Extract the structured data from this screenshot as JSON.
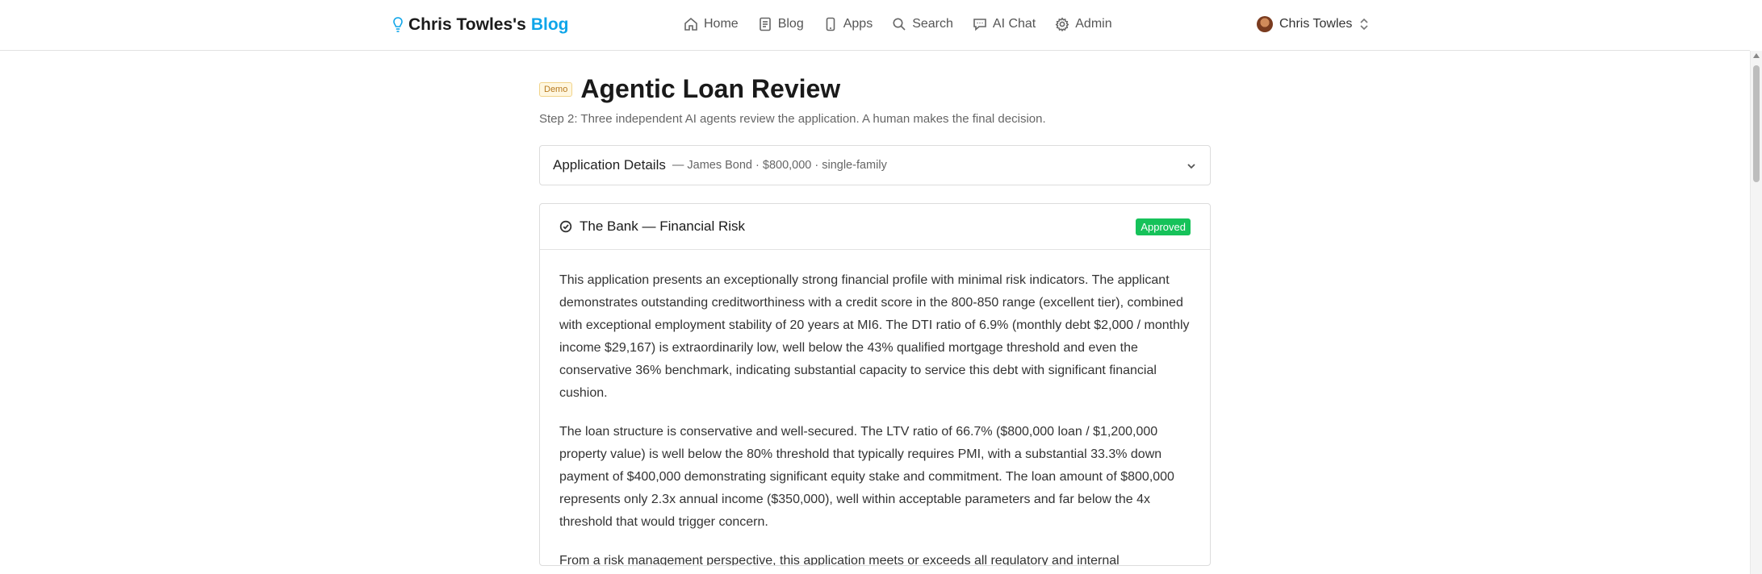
{
  "header": {
    "brand_name": "Chris Towles's",
    "brand_accent": "Blog",
    "nav": [
      {
        "label": "Home",
        "icon": "home-icon"
      },
      {
        "label": "Blog",
        "icon": "document-icon"
      },
      {
        "label": "Apps",
        "icon": "phone-icon"
      },
      {
        "label": "Search",
        "icon": "search-icon"
      },
      {
        "label": "AI Chat",
        "icon": "chat-icon"
      },
      {
        "label": "Admin",
        "icon": "gear-icon"
      }
    ],
    "user_name": "Chris Towles"
  },
  "page": {
    "badge": "Demo",
    "title": "Agentic Loan Review",
    "subtitle": "Step 2: Three independent AI agents review the application. A human makes the final decision."
  },
  "application_details": {
    "title": "Application Details",
    "summary": "— James Bond · $800,000 · single-family"
  },
  "review_card": {
    "title": "The Bank — Financial Risk",
    "status": "Approved",
    "paragraphs": [
      "This application presents an exceptionally strong financial profile with minimal risk indicators. The applicant demonstrates outstanding creditworthiness with a credit score in the 800-850 range (excellent tier), combined with exceptional employment stability of 20 years at MI6. The DTI ratio of 6.9% (monthly debt $2,000 / monthly income $29,167) is extraordinarily low, well below the 43% qualified mortgage threshold and even the conservative 36% benchmark, indicating substantial capacity to service this debt with significant financial cushion.",
      "The loan structure is conservative and well-secured. The LTV ratio of 66.7% ($800,000 loan / $1,200,000 property value) is well below the 80% threshold that typically requires PMI, with a substantial 33.3% down payment of $400,000 demonstrating significant equity stake and commitment. The loan amount of $800,000 represents only 2.3x annual income ($350,000), well within acceptable parameters and far below the 4x threshold that would trigger concern.",
      "From a risk management perspective, this application meets or exceeds all regulatory and internal"
    ]
  },
  "colors": {
    "brand_accent": "#0ea5e9",
    "approved": "#16c25a",
    "demo_badge_bg": "#fff7e0"
  }
}
